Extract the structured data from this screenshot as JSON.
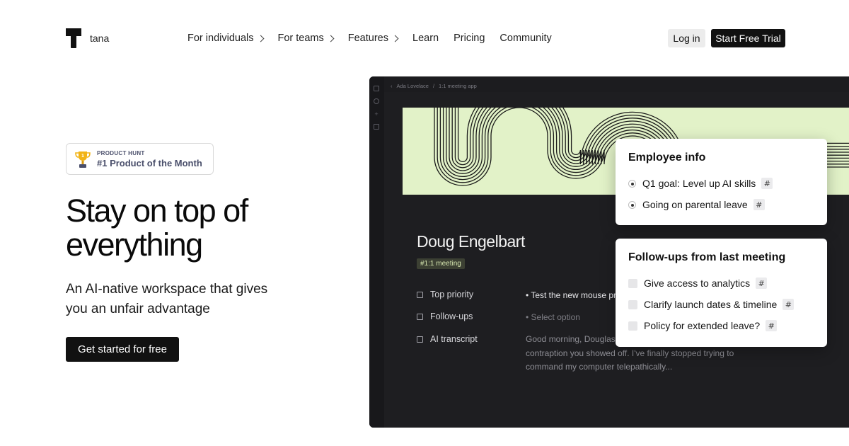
{
  "brand": {
    "name": "tana"
  },
  "nav": {
    "items": [
      {
        "label": "For individuals",
        "has_submenu": true
      },
      {
        "label": "For teams",
        "has_submenu": true
      },
      {
        "label": "Features",
        "has_submenu": true
      },
      {
        "label": "Learn",
        "has_submenu": false
      },
      {
        "label": "Pricing",
        "has_submenu": false
      },
      {
        "label": "Community",
        "has_submenu": false
      }
    ],
    "login_label": "Log in",
    "trial_label": "Start Free Trial"
  },
  "hero": {
    "badge": {
      "small": "PRODUCT HUNT",
      "big": "#1 Product of the Month"
    },
    "headline": "Stay on top of everything",
    "subheadline": "An AI-native workspace that gives you an unfair advantage",
    "cta_label": "Get started for free"
  },
  "app_preview": {
    "breadcrumb": [
      "Ada Lovelace",
      "/",
      "1:1 meeting app"
    ],
    "doc_title": "Doug Engelbart",
    "doc_tag": "#1:1 meeting",
    "fields": [
      {
        "label": "Top priority",
        "value": "• Test the new mouse prototy"
      },
      {
        "label": "Follow-ups",
        "value": "• Select option"
      },
      {
        "label": "AI transcript",
        "value": ""
      }
    ],
    "transcript": "Good morning, Douglas. Be —I love the new \"mouse\" contraption you showed off. I've finally stopped trying to command my computer telepathically..."
  },
  "cards": {
    "employee": {
      "title": "Employee info",
      "items": [
        "Q1 goal: Level up AI skills",
        "Going on parental leave"
      ]
    },
    "followups": {
      "title": "Follow-ups from last meeting",
      "items": [
        "Give access to analytics",
        "Clarify launch dates & timeline",
        "Policy for extended leave?"
      ]
    },
    "tag_symbol": "#"
  },
  "colors": {
    "banner": "#e2f2c8",
    "app_bg": "#1c1c1f",
    "tag_bg": "#3c4033",
    "primary_button": "#111111"
  }
}
